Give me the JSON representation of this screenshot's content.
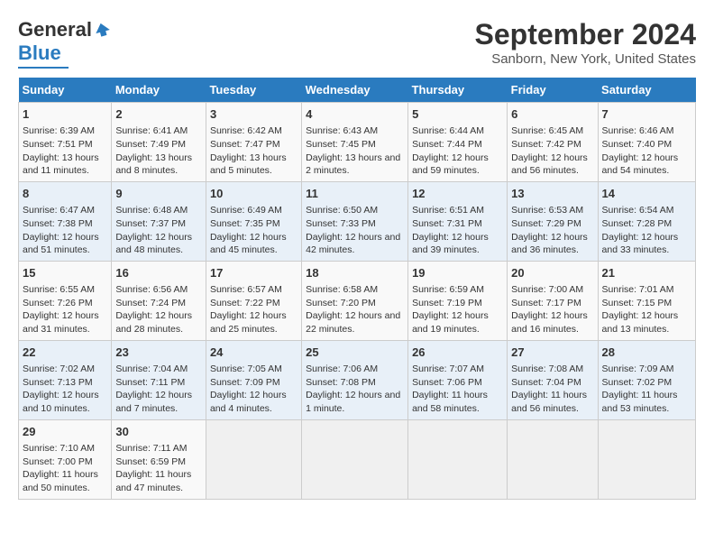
{
  "header": {
    "logo": {
      "line1": "General",
      "line2": "Blue"
    },
    "title": "September 2024",
    "subtitle": "Sanborn, New York, United States"
  },
  "days_of_week": [
    "Sunday",
    "Monday",
    "Tuesday",
    "Wednesday",
    "Thursday",
    "Friday",
    "Saturday"
  ],
  "weeks": [
    [
      {
        "day": "1",
        "sunrise": "6:39 AM",
        "sunset": "7:51 PM",
        "daylight": "13 hours and 11 minutes."
      },
      {
        "day": "2",
        "sunrise": "6:41 AM",
        "sunset": "7:49 PM",
        "daylight": "13 hours and 8 minutes."
      },
      {
        "day": "3",
        "sunrise": "6:42 AM",
        "sunset": "7:47 PM",
        "daylight": "13 hours and 5 minutes."
      },
      {
        "day": "4",
        "sunrise": "6:43 AM",
        "sunset": "7:45 PM",
        "daylight": "13 hours and 2 minutes."
      },
      {
        "day": "5",
        "sunrise": "6:44 AM",
        "sunset": "7:44 PM",
        "daylight": "12 hours and 59 minutes."
      },
      {
        "day": "6",
        "sunrise": "6:45 AM",
        "sunset": "7:42 PM",
        "daylight": "12 hours and 56 minutes."
      },
      {
        "day": "7",
        "sunrise": "6:46 AM",
        "sunset": "7:40 PM",
        "daylight": "12 hours and 54 minutes."
      }
    ],
    [
      {
        "day": "8",
        "sunrise": "6:47 AM",
        "sunset": "7:38 PM",
        "daylight": "12 hours and 51 minutes."
      },
      {
        "day": "9",
        "sunrise": "6:48 AM",
        "sunset": "7:37 PM",
        "daylight": "12 hours and 48 minutes."
      },
      {
        "day": "10",
        "sunrise": "6:49 AM",
        "sunset": "7:35 PM",
        "daylight": "12 hours and 45 minutes."
      },
      {
        "day": "11",
        "sunrise": "6:50 AM",
        "sunset": "7:33 PM",
        "daylight": "12 hours and 42 minutes."
      },
      {
        "day": "12",
        "sunrise": "6:51 AM",
        "sunset": "7:31 PM",
        "daylight": "12 hours and 39 minutes."
      },
      {
        "day": "13",
        "sunrise": "6:53 AM",
        "sunset": "7:29 PM",
        "daylight": "12 hours and 36 minutes."
      },
      {
        "day": "14",
        "sunrise": "6:54 AM",
        "sunset": "7:28 PM",
        "daylight": "12 hours and 33 minutes."
      }
    ],
    [
      {
        "day": "15",
        "sunrise": "6:55 AM",
        "sunset": "7:26 PM",
        "daylight": "12 hours and 31 minutes."
      },
      {
        "day": "16",
        "sunrise": "6:56 AM",
        "sunset": "7:24 PM",
        "daylight": "12 hours and 28 minutes."
      },
      {
        "day": "17",
        "sunrise": "6:57 AM",
        "sunset": "7:22 PM",
        "daylight": "12 hours and 25 minutes."
      },
      {
        "day": "18",
        "sunrise": "6:58 AM",
        "sunset": "7:20 PM",
        "daylight": "12 hours and 22 minutes."
      },
      {
        "day": "19",
        "sunrise": "6:59 AM",
        "sunset": "7:19 PM",
        "daylight": "12 hours and 19 minutes."
      },
      {
        "day": "20",
        "sunrise": "7:00 AM",
        "sunset": "7:17 PM",
        "daylight": "12 hours and 16 minutes."
      },
      {
        "day": "21",
        "sunrise": "7:01 AM",
        "sunset": "7:15 PM",
        "daylight": "12 hours and 13 minutes."
      }
    ],
    [
      {
        "day": "22",
        "sunrise": "7:02 AM",
        "sunset": "7:13 PM",
        "daylight": "12 hours and 10 minutes."
      },
      {
        "day": "23",
        "sunrise": "7:04 AM",
        "sunset": "7:11 PM",
        "daylight": "12 hours and 7 minutes."
      },
      {
        "day": "24",
        "sunrise": "7:05 AM",
        "sunset": "7:09 PM",
        "daylight": "12 hours and 4 minutes."
      },
      {
        "day": "25",
        "sunrise": "7:06 AM",
        "sunset": "7:08 PM",
        "daylight": "12 hours and 1 minute."
      },
      {
        "day": "26",
        "sunrise": "7:07 AM",
        "sunset": "7:06 PM",
        "daylight": "11 hours and 58 minutes."
      },
      {
        "day": "27",
        "sunrise": "7:08 AM",
        "sunset": "7:04 PM",
        "daylight": "11 hours and 56 minutes."
      },
      {
        "day": "28",
        "sunrise": "7:09 AM",
        "sunset": "7:02 PM",
        "daylight": "11 hours and 53 minutes."
      }
    ],
    [
      {
        "day": "29",
        "sunrise": "7:10 AM",
        "sunset": "7:00 PM",
        "daylight": "11 hours and 50 minutes."
      },
      {
        "day": "30",
        "sunrise": "7:11 AM",
        "sunset": "6:59 PM",
        "daylight": "11 hours and 47 minutes."
      },
      null,
      null,
      null,
      null,
      null
    ]
  ]
}
